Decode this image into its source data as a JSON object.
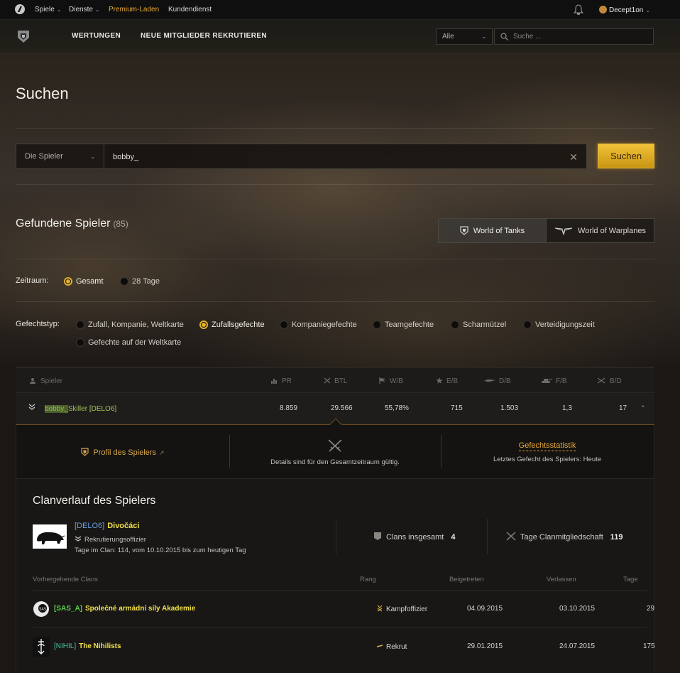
{
  "topbar": {
    "nav": [
      {
        "label": "Spiele",
        "has_menu": true
      },
      {
        "label": "Dienste",
        "has_menu": true
      },
      {
        "label": "Premium-Laden",
        "has_menu": false,
        "color": "#e8a838"
      },
      {
        "label": "Kundendienst",
        "has_menu": false
      }
    ],
    "user": "Decept1on"
  },
  "subbar": {
    "nav": [
      "WERTUNGEN",
      "NEUE MITGLIEDER REKRUTIEREN"
    ],
    "scope_value": "Alle",
    "search_placeholder": "Suche ..."
  },
  "page_title": "Suchen",
  "search": {
    "type_value": "Die Spieler",
    "query": "bobby_",
    "button": "Suchen"
  },
  "results": {
    "title": "Gefundene Spieler",
    "count": "(85)"
  },
  "game_tabs": [
    {
      "label": "World of Tanks",
      "active": true
    },
    {
      "label": "World of Warplanes",
      "active": false
    }
  ],
  "zeitraum": {
    "label": "Zeitraum:",
    "options": [
      {
        "label": "Gesamt",
        "selected": true
      },
      {
        "label": "28 Tage",
        "selected": false
      }
    ]
  },
  "gefechtstyp": {
    "label": "Gefechtstyp:",
    "options": [
      {
        "label": "Zufall, Kompanie, Weltkarte",
        "selected": false
      },
      {
        "label": "Zufallsgefechte",
        "selected": true
      },
      {
        "label": "Kompaniegefechte",
        "selected": false
      },
      {
        "label": "Teamgefechte",
        "selected": false
      },
      {
        "label": "Scharmützel",
        "selected": false
      },
      {
        "label": "Verteidigungszeit",
        "selected": false
      },
      {
        "label": "Gefechte auf der Weltkarte",
        "selected": false
      }
    ]
  },
  "table": {
    "columns": [
      "Spieler",
      "PR",
      "BTL",
      "W/B",
      "E/B",
      "D/B",
      "F/B",
      "B/D"
    ],
    "row": {
      "name_highlight": "bobby_",
      "name_rest": "Skiller",
      "clan": "[DELO6]",
      "values": [
        "8.859",
        "29.566",
        "55,78%",
        "715",
        "1.503",
        "1,3",
        "17"
      ]
    }
  },
  "detail": {
    "profile_link": "Profil des Spielers",
    "period_note": "Details sind für den Gesamtzeitraum gültig.",
    "stats_link": "Gefechtsstatistik",
    "last_battle": "Letztes Gefecht des Spielers: Heute"
  },
  "clan_history": {
    "title": "Clanverlauf des Spielers",
    "current": {
      "tag": "[DELO6]",
      "name": "Divočáci",
      "role": "Rekrutierungsoffizier",
      "since": "Tage im Clan: 114, vom 10.10.2015 bis zum heutigen Tag"
    },
    "clans_total_label": "Clans insgesamt",
    "clans_total": "4",
    "days_label": "Tage Clanmitgliedschaft",
    "days": "119",
    "columns": [
      "Vorhergehende Clans",
      "Rang",
      "Beigetreten",
      "Verlassen",
      "Tage"
    ],
    "rows": [
      {
        "tag": "[SAS_A]",
        "name": "Společné armádní síly Akademie",
        "rank": "Kampfoffizier",
        "joined": "04.09.2015",
        "left": "03.10.2015",
        "days": "29"
      },
      {
        "tag": "[NIHIL]",
        "name": "The Nihilists",
        "rank": "Rekrut",
        "joined": "29.01.2015",
        "left": "24.07.2015",
        "days": "175"
      }
    ]
  }
}
